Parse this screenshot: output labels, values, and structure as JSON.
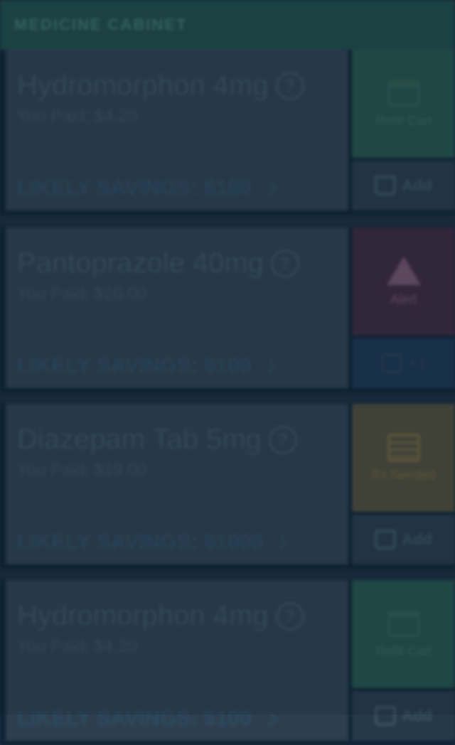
{
  "header": {
    "title": "MEDICINE CABINET"
  },
  "cards": [
    {
      "name": "Hydromorphon 4mg",
      "price": "You Paid: $4.20",
      "savings": "LIKELY SAVINGS: $100",
      "status_label": "Refill Cart",
      "status_icon": "calendar-icon",
      "status_color": "#24504a",
      "cart_count": "Add",
      "cart_color": "#26394b"
    },
    {
      "name": "Pantoprazole 40mg",
      "price": "You Paid: $26.00",
      "savings": "LIKELY SAVINGS: $100",
      "status_label": "Alert",
      "status_icon": "warning-icon",
      "status_color": "#3a2a40",
      "cart_count": "+1",
      "cart_color": "#1c3550"
    },
    {
      "name": "Diazepam Tab 5mg",
      "price": "You Paid: $19.00",
      "savings": "LIKELY SAVINGS: $1000",
      "status_label": "Rx Needed",
      "status_icon": "document-icon",
      "status_color": "#4a4a3c",
      "cart_count": "Add",
      "cart_color": "#26394b"
    },
    {
      "name": "Hydromorphon 4mg",
      "price": "You Paid: $4.20",
      "savings": "LIKELY SAVINGS: $100",
      "status_label": "Refill Cart",
      "status_icon": "calendar-icon",
      "status_color": "#24504a",
      "cart_count": "Add",
      "cart_color": "#26394b"
    }
  ]
}
